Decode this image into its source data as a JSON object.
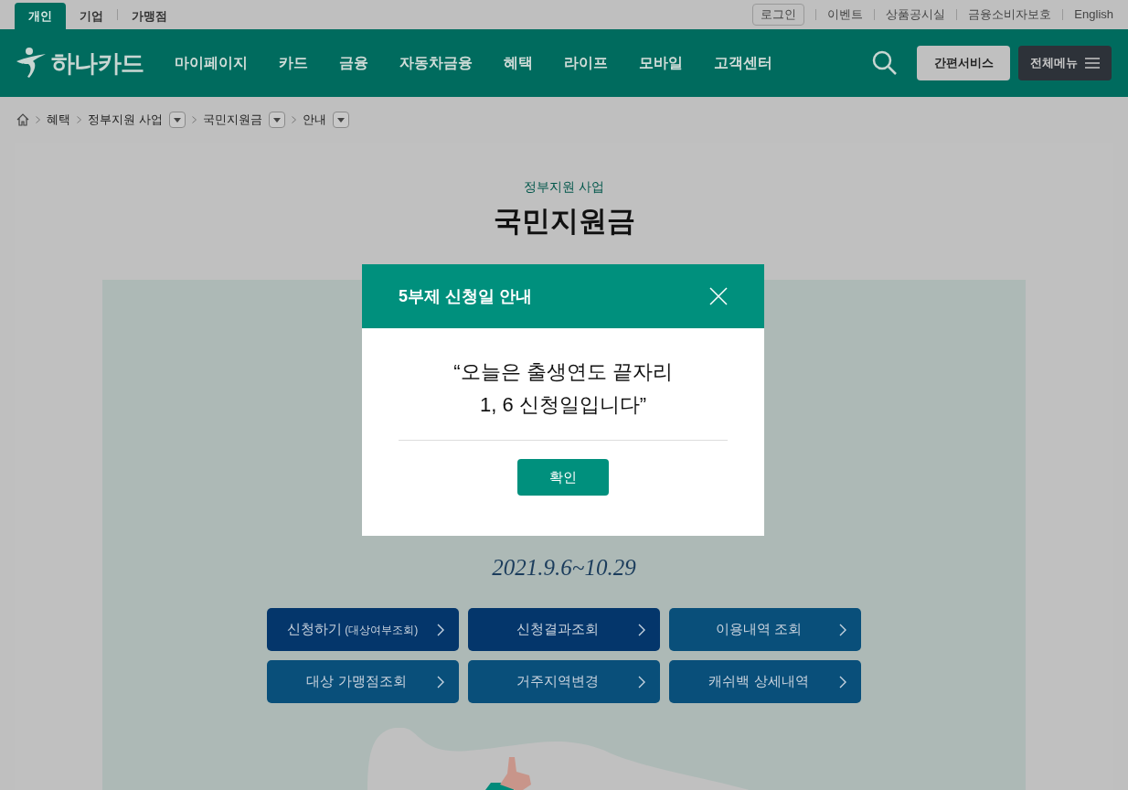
{
  "top_tabs": [
    {
      "label": "개인",
      "selected": true
    },
    {
      "label": "기업",
      "selected": false
    },
    {
      "label": "가맹점",
      "selected": false
    }
  ],
  "utility": {
    "login": "로그인",
    "links": [
      "이벤트",
      "상품공시실",
      "금융소비자보호",
      "English"
    ]
  },
  "header": {
    "logo": "하나카드",
    "nav": [
      "마이페이지",
      "카드",
      "금융",
      "자동차금융",
      "혜택",
      "라이프",
      "모바일",
      "고객센터"
    ],
    "quick_button": "간편서비스",
    "menu_button": "전체메뉴"
  },
  "breadcrumb": [
    {
      "label": "혜택",
      "dropdown": false
    },
    {
      "label": "정부지원 사업",
      "dropdown": true
    },
    {
      "label": "국민지원금",
      "dropdown": true
    },
    {
      "label": "안내",
      "dropdown": true
    }
  ],
  "page": {
    "category": "정부지원 사업",
    "title": "국민지원금",
    "period": "2021.9.6~10.29",
    "actions": [
      {
        "label": "신청하기",
        "note": "(대상여부조회)",
        "kind": "primary"
      },
      {
        "label": "신청결과조회",
        "kind": "primary"
      },
      {
        "label": "이용내역 조회",
        "kind": "secondary"
      },
      {
        "label": "대상 가맹점조회",
        "kind": "secondary"
      },
      {
        "label": "거주지역변경",
        "kind": "secondary"
      },
      {
        "label": "캐쉬백 상세내역",
        "kind": "secondary"
      }
    ]
  },
  "modal": {
    "title": "5부제 신청일 안내",
    "message": [
      "“오늘은 출생연도 끝자리",
      "1, 6 신청일입니다”"
    ],
    "confirm": "확인"
  }
}
